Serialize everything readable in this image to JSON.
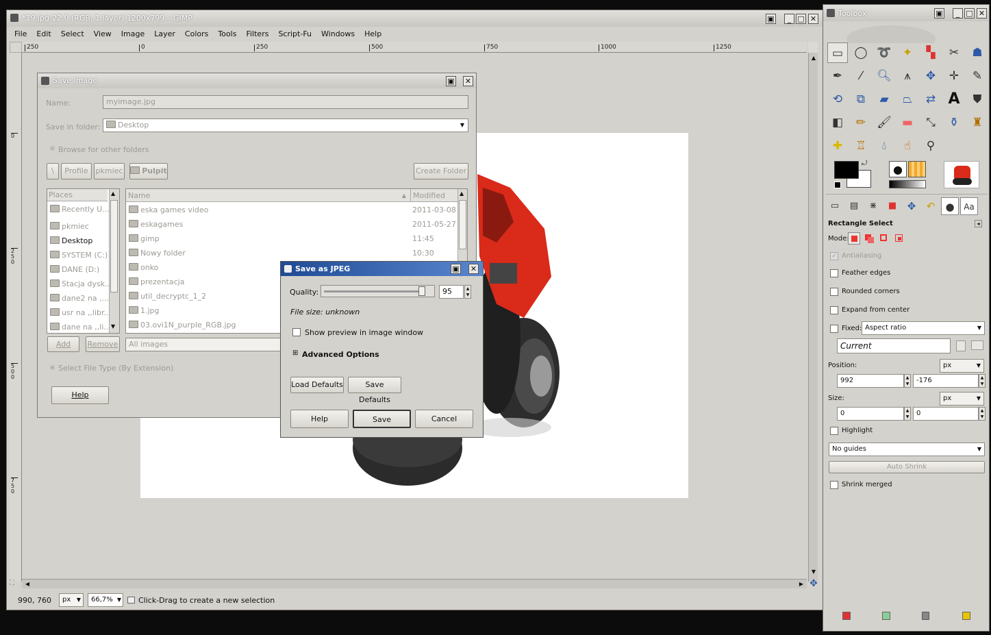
{
  "gimp": {
    "title": "*19.jpg-22.0 (RGB, 1 layer) 1200x799 – GIMP",
    "menu": [
      "File",
      "Edit",
      "Select",
      "View",
      "Image",
      "Layer",
      "Colors",
      "Tools",
      "Filters",
      "Script-Fu",
      "Windows",
      "Help"
    ],
    "hruler": [
      "250",
      "0",
      "250",
      "500",
      "750",
      "1000",
      "1250"
    ],
    "vruler": [
      "0",
      "250",
      "500",
      "750"
    ],
    "status": {
      "coords": "990, 760",
      "unit": "px",
      "zoom": "66,7%",
      "message": "Click-Drag to create a new selection"
    }
  },
  "save_image": {
    "title": "Save Image",
    "name_label": "Name:",
    "name_value": "myimage.jpg",
    "folder_label": "Save in folder:",
    "folder_value": "Desktop",
    "browse_label": "Browse for other folders",
    "path_buttons": [
      "\\",
      "Profile",
      "pkmiec",
      "Pulpit"
    ],
    "create_folder": "Create Folder",
    "places_header": "Places",
    "places": [
      "Recently U...",
      "pkmiec",
      "Desktop",
      "SYSTEM (C:)",
      "DANE (D:)",
      "Stacja dysk...",
      "dane2 na ,...",
      "usr na ,,libr...",
      "dane na ,,li..."
    ],
    "name_header": "Name",
    "modified_header": "Modified",
    "files": [
      {
        "name": "eska games video",
        "modified": "2011-03-08"
      },
      {
        "name": "eskagames",
        "modified": "2011-05-27"
      },
      {
        "name": "gimp",
        "modified": "11:45"
      },
      {
        "name": "Nowy folder",
        "modified": "10:30"
      },
      {
        "name": "onko",
        "modified": ""
      },
      {
        "name": "prezentacja",
        "modified": ""
      },
      {
        "name": "util_decryptc_1_2",
        "modified": ""
      },
      {
        "name": "1.jpg",
        "modified": ""
      },
      {
        "name": "03.ovi1N_purple_RGB.jpg",
        "modified": ""
      }
    ],
    "add_label": "Add",
    "remove_label": "Remove",
    "filter_value": "All images",
    "file_type_label": "Select File Type (By Extension)",
    "help_label": "Help"
  },
  "save_jpeg": {
    "title": "Save as JPEG",
    "quality_label": "Quality:",
    "quality_value": "95",
    "quality_fraction": 0.95,
    "file_size": "File size: unknown",
    "preview_label": "Show preview in image window",
    "advanced_label": "Advanced Options",
    "load_defaults": "Load Defaults",
    "save_defaults": "Save Defaults",
    "help_label": "Help",
    "save_label": "Save",
    "cancel_label": "Cancel"
  },
  "toolbox": {
    "title": "Toolbox",
    "tool_options_title": "Rectangle Select",
    "mode_label": "Mode:",
    "antialiasing": "Antialiasing",
    "feather": "Feather edges",
    "rounded": "Rounded corners",
    "expand": "Expand from center",
    "fixed": "Fixed:",
    "fixed_value": "Aspect ratio",
    "current_value": "Current",
    "position_label": "Position:",
    "position_unit": "px",
    "position_x": "992",
    "position_y": "-176",
    "size_label": "Size:",
    "size_unit": "px",
    "size_w": "0",
    "size_h": "0",
    "highlight": "Highlight",
    "guides_value": "No guides",
    "auto_shrink": "Auto Shrink",
    "shrink_merged": "Shrink merged",
    "font_tab": "Aa",
    "text_tool": "A"
  },
  "colors": {
    "titlebar_blue": "#2d5aa8",
    "canvas_grey": "#d4d2cc",
    "jeep_red": "#d92a1a"
  }
}
